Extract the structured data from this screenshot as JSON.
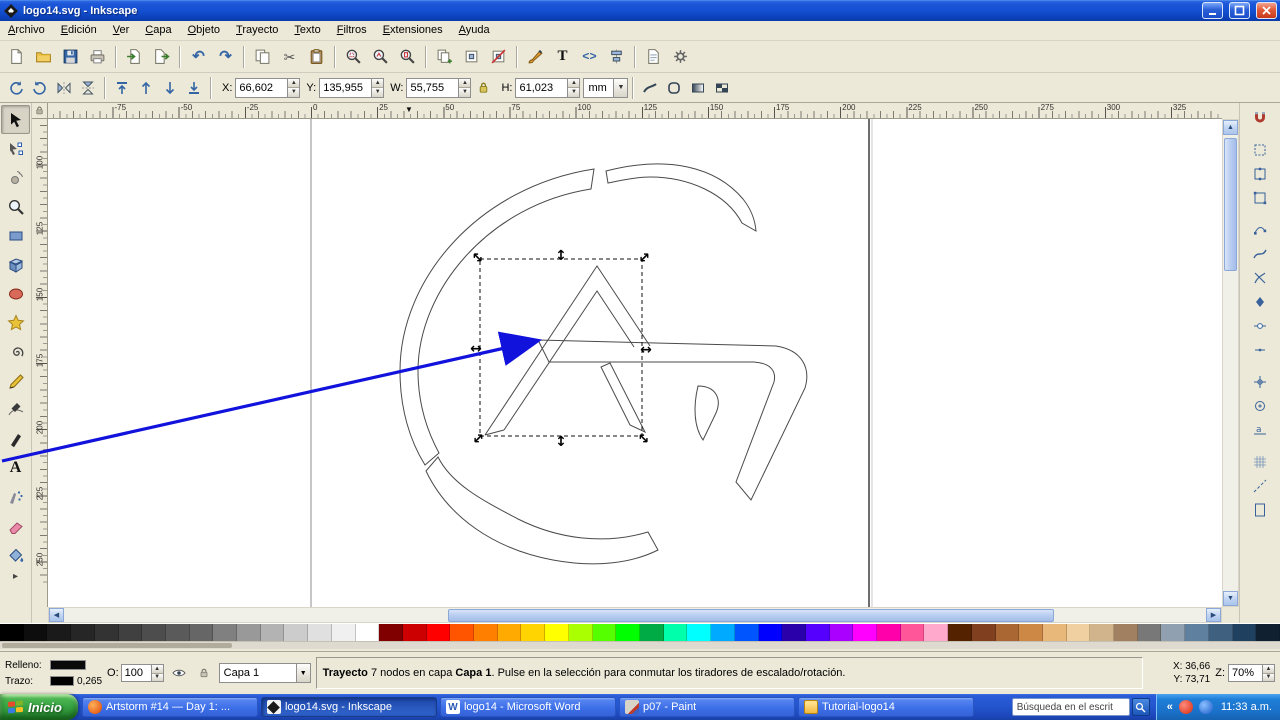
{
  "window": {
    "title": "logo14.svg - Inkscape"
  },
  "menus": [
    "Archivo",
    "Edición",
    "Ver",
    "Capa",
    "Objeto",
    "Trayecto",
    "Texto",
    "Filtros",
    "Extensiones",
    "Ayuda"
  ],
  "tool_controls": {
    "x_label": "X:",
    "x_value": "66,602",
    "y_label": "Y:",
    "y_value": "135,955",
    "w_label": "W:",
    "w_value": "55,755",
    "h_label": "H:",
    "h_value": "61,023",
    "units_value": "mm"
  },
  "rulers": {
    "h_labels": [
      "-75",
      "-50",
      "-25",
      "0",
      "25",
      "50",
      "75",
      "100",
      "125",
      "150",
      "175",
      "200",
      "225",
      "250",
      "275",
      "300",
      "325"
    ],
    "v_labels": [
      "100",
      "125",
      "150",
      "175",
      "200",
      "225",
      "250"
    ]
  },
  "status_bar": {
    "fill_label": "Relleno:",
    "stroke_label": "Trazo:",
    "stroke_width": "0,265",
    "fill_color": "#0a0a0a",
    "stroke_color": "#000000",
    "opacity_label": "O:",
    "opacity_value": "100",
    "layer_label": "Capa 1",
    "message_parts": {
      "b1": "Trayecto",
      "t1": " 7 nodos en capa ",
      "b2": "Capa 1",
      "t2": ". Pulse en la selección para conmutar los tiradores de escalado/rotación."
    },
    "cursor_x_label": "X:",
    "cursor_x": "36,66",
    "cursor_y_label": "Y:",
    "cursor_y": "73,71",
    "zoom_label": "Z:",
    "zoom_value": "70%"
  },
  "taskbar": {
    "start_label": "Inicio",
    "tasks": [
      {
        "label": "Artstorm #14 — Day 1: ...",
        "icon": "artstorm",
        "active": false
      },
      {
        "label": "logo14.svg - Inkscape",
        "icon": "inkscape",
        "active": true
      },
      {
        "label": "logo14 - Microsoft Word",
        "icon": "word",
        "icon_text": "W",
        "active": false
      },
      {
        "label": "p07 - Paint",
        "icon": "paint",
        "active": false
      },
      {
        "label": "Tutorial-logo14",
        "icon": "folder",
        "active": false
      }
    ],
    "search_value": "Búsqueda en el escrit",
    "clock": "11:33 a.m."
  },
  "palette": {
    "colors": [
      "#000000",
      "#0d0d0d",
      "#1a1a1a",
      "#262626",
      "#333333",
      "#404040",
      "#4d4d4d",
      "#5a5a5a",
      "#666666",
      "#808080",
      "#999999",
      "#b3b3b3",
      "#cccccc",
      "#e0e0e0",
      "#f0f0f0",
      "#ffffff",
      "#800000",
      "#cc0000",
      "#ff0000",
      "#ff5500",
      "#ff7f00",
      "#ffaa00",
      "#ffd400",
      "#ffff00",
      "#aaff00",
      "#55ff00",
      "#00ff00",
      "#00aa44",
      "#00ffaa",
      "#00ffff",
      "#00aaff",
      "#0055ff",
      "#0000ff",
      "#2a00aa",
      "#5500ff",
      "#aa00ff",
      "#ff00ff",
      "#ff00aa",
      "#ff5599",
      "#ffaacc",
      "#552200",
      "#804020",
      "#aa6633",
      "#cc8844",
      "#e8b87a",
      "#f0d0a0",
      "#d2b48c",
      "#a08060",
      "#787878",
      "#90a0b0",
      "#6080a0",
      "#406080",
      "#204060",
      "#102030"
    ]
  },
  "colors": {
    "titlebar_blue": "#1450d2",
    "taskbar_blue": "#2456cf",
    "start_green": "#3aa544",
    "toolbar_beige": "#ECE9D8",
    "annotation_arrow": "#1212dd"
  }
}
